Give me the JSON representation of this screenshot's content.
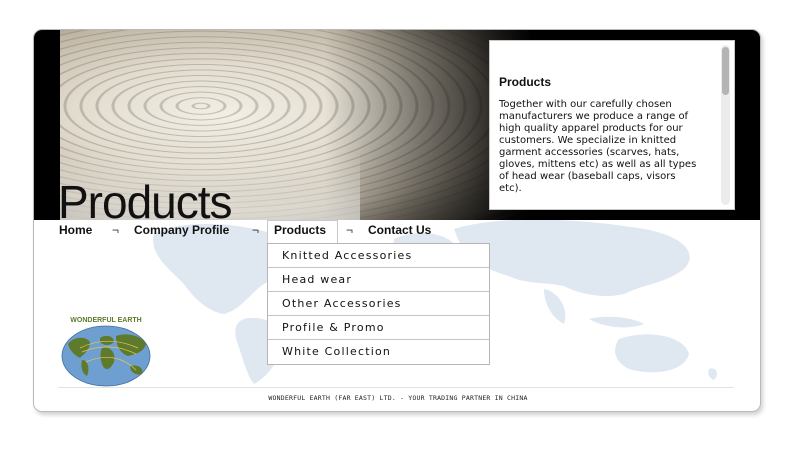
{
  "header": {
    "title": "Products"
  },
  "info_panel": {
    "heading": "Products",
    "text": "Together with our carefully chosen manufacturers we produce a range of high quality apparel products for our customers. We specialize in knitted garment accessories (scarves, hats, gloves, mittens etc) as well as all types of head wear (baseball caps, visors etc)."
  },
  "nav": {
    "items": [
      {
        "label": "Home"
      },
      {
        "label": "Company Profile"
      },
      {
        "label": "Products"
      },
      {
        "label": "Contact Us"
      }
    ],
    "separator": "¬"
  },
  "dropdown": {
    "items": [
      {
        "label": "Knitted Accessories"
      },
      {
        "label": "Head wear"
      },
      {
        "label": "Other Accessories"
      },
      {
        "label": "Profile & Promo"
      },
      {
        "label": "White Collection"
      }
    ]
  },
  "logo": {
    "text": "WONDERFUL EARTH"
  },
  "footer": {
    "text": "WONDERFUL EARTH (FAR EAST) LTD. - YOUR TRADING PARTNER IN CHINA"
  },
  "colors": {
    "header_background": "#000000",
    "map_tint": "#dfe7f1",
    "logo_globe": "#6f9fd0",
    "logo_land": "#5e7a2c"
  }
}
